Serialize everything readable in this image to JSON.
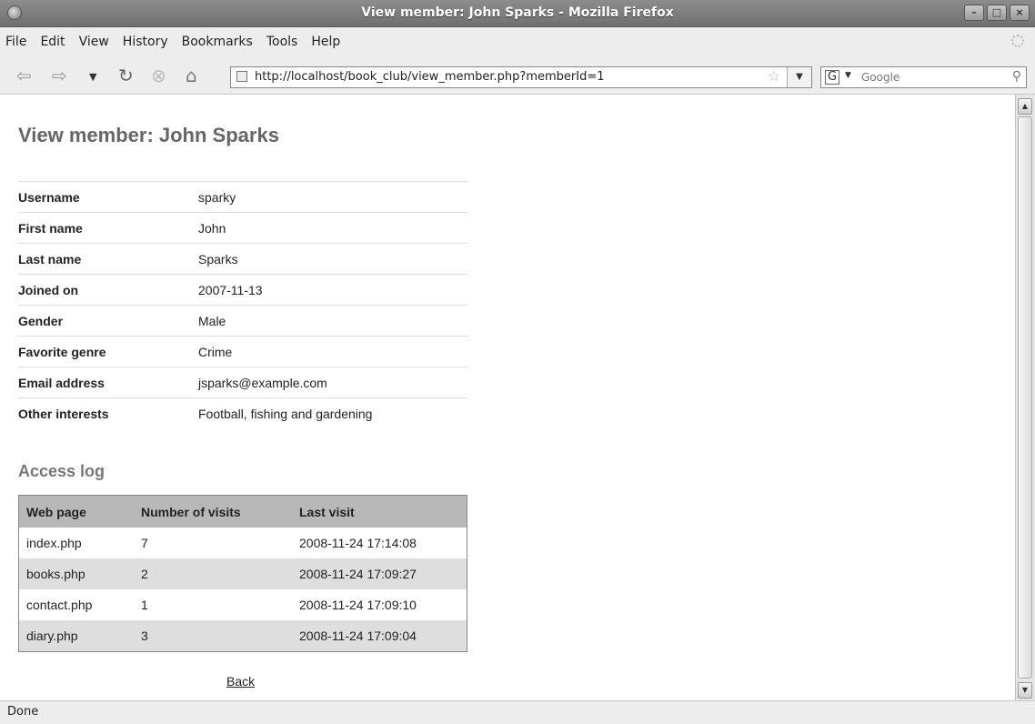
{
  "window": {
    "title": "View member: John Sparks - Mozilla Firefox"
  },
  "menu": [
    "File",
    "Edit",
    "View",
    "History",
    "Bookmarks",
    "Tools",
    "Help"
  ],
  "nav": {
    "url": "http://localhost/book_club/view_member.php?memberId=1",
    "search_placeholder": "Google",
    "search_engine": "G"
  },
  "page": {
    "title": "View member: John Sparks",
    "details": [
      {
        "label": "Username",
        "value": "sparky"
      },
      {
        "label": "First name",
        "value": "John"
      },
      {
        "label": "Last name",
        "value": "Sparks"
      },
      {
        "label": "Joined on",
        "value": "2007-11-13"
      },
      {
        "label": "Gender",
        "value": "Male"
      },
      {
        "label": "Favorite genre",
        "value": "Crime"
      },
      {
        "label": "Email address",
        "value": "jsparks@example.com"
      },
      {
        "label": "Other interests",
        "value": "Football, fishing and gardening"
      }
    ],
    "access_log_title": "Access log",
    "log_headers": [
      "Web page",
      "Number of visits",
      "Last visit"
    ],
    "log_rows": [
      [
        "index.php",
        "7",
        "2008-11-24 17:14:08"
      ],
      [
        "books.php",
        "2",
        "2008-11-24 17:09:27"
      ],
      [
        "contact.php",
        "1",
        "2008-11-24 17:09:10"
      ],
      [
        "diary.php",
        "3",
        "2008-11-24 17:09:04"
      ]
    ],
    "back_label": "Back"
  },
  "status": "Done"
}
